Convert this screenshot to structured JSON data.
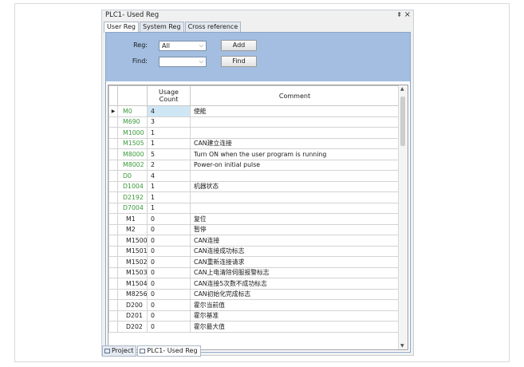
{
  "window": {
    "title": "PLC1- Used Reg",
    "pin_glyph": "⇞",
    "close_glyph": "×"
  },
  "tabs": [
    {
      "label": "User Reg",
      "active": true
    },
    {
      "label": "System Reg",
      "active": false
    },
    {
      "label": "Cross reference",
      "active": false
    }
  ],
  "filter": {
    "reg_label": "Reg:",
    "reg_value": "All",
    "find_label": "Find:",
    "find_value": "",
    "add_label": "Add",
    "find_button_label": "Find"
  },
  "table": {
    "columns": [
      "",
      "Usage Count",
      "Comment"
    ],
    "rows": [
      {
        "reg": "M0",
        "count": "4",
        "comment": "使能",
        "used": true,
        "selected": true
      },
      {
        "reg": "M690",
        "count": "3",
        "comment": "",
        "used": true
      },
      {
        "reg": "M1000",
        "count": "1",
        "comment": "",
        "used": true
      },
      {
        "reg": "M1505",
        "count": "1",
        "comment": "CAN建立连接",
        "used": true
      },
      {
        "reg": "M8000",
        "count": "5",
        "comment": "Turn ON when the user program is running",
        "used": true
      },
      {
        "reg": "M8002",
        "count": "2",
        "comment": "Power-on initial pulse",
        "used": true
      },
      {
        "reg": "D0",
        "count": "4",
        "comment": "",
        "used": true
      },
      {
        "reg": "D1004",
        "count": "1",
        "comment": "机器状态",
        "used": true
      },
      {
        "reg": "D2192",
        "count": "1",
        "comment": "",
        "used": true
      },
      {
        "reg": "D7004",
        "count": "1",
        "comment": "",
        "used": true
      },
      {
        "reg": "M1",
        "count": "0",
        "comment": "复位",
        "used": false
      },
      {
        "reg": "M2",
        "count": "0",
        "comment": "暂停",
        "used": false
      },
      {
        "reg": "M1500",
        "count": "0",
        "comment": "CAN连接",
        "used": false
      },
      {
        "reg": "M1501",
        "count": "0",
        "comment": "CAN连接成功标志",
        "used": false
      },
      {
        "reg": "M1502",
        "count": "0",
        "comment": "CAN重新连接请求",
        "used": false
      },
      {
        "reg": "M1503",
        "count": "0",
        "comment": "CAN上电清除伺服报警标志",
        "used": false
      },
      {
        "reg": "M1504",
        "count": "0",
        "comment": "CAN连接5次数不成功标志",
        "used": false
      },
      {
        "reg": "M8256",
        "count": "0",
        "comment": "CAN初始化完成标志",
        "used": false
      },
      {
        "reg": "D200",
        "count": "0",
        "comment": "霍尔当前值",
        "used": false
      },
      {
        "reg": "D201",
        "count": "0",
        "comment": "霍尔基准",
        "used": false
      },
      {
        "reg": "D202",
        "count": "0",
        "comment": "霍尔最大值",
        "used": false
      }
    ]
  },
  "bottom_tabs": [
    {
      "label": "Project",
      "active": false
    },
    {
      "label": "PLC1- Used Reg",
      "active": true
    }
  ],
  "colors": {
    "used_reg": "#3a9a3a",
    "filter_bg": "#a3bee0",
    "selection": "#cfe7f5"
  },
  "icons": {
    "selected_row": "row-pointer-icon",
    "dropdown": "chevron-down-icon"
  }
}
